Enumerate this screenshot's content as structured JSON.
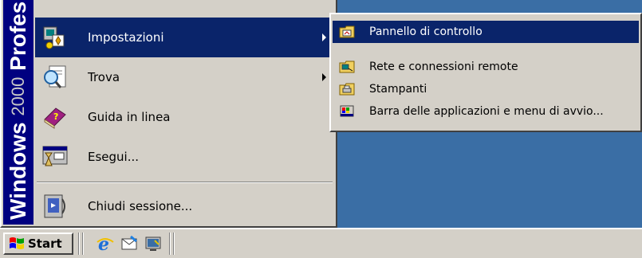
{
  "start_menu": {
    "brand": {
      "windows": "Windows",
      "version": "2000",
      "edition": "Profes"
    },
    "items": [
      {
        "label": "Impostazioni",
        "icon": "settings-icon",
        "has_submenu": true,
        "selected": true
      },
      {
        "label": "Trova",
        "icon": "search-icon",
        "has_submenu": true,
        "selected": false
      },
      {
        "label": "Guida in linea",
        "icon": "help-book-icon",
        "has_submenu": false,
        "selected": false
      },
      {
        "label": "Esegui...",
        "icon": "run-icon",
        "has_submenu": false,
        "selected": false
      },
      {
        "label": "Chiudi sessione...",
        "icon": "logoff-icon",
        "has_submenu": false,
        "selected": false
      }
    ]
  },
  "submenu": {
    "items": [
      {
        "label": "Pannello di controllo",
        "icon": "control-panel-icon",
        "selected": true
      },
      {
        "label": "Rete e connessioni remote",
        "icon": "network-icon",
        "selected": false
      },
      {
        "label": "Stampanti",
        "icon": "printer-folder-icon",
        "selected": false
      },
      {
        "label": "Barra delle applicazioni e menu di avvio...",
        "icon": "taskbar-settings-icon",
        "selected": false
      }
    ]
  },
  "taskbar": {
    "start_label": "Start",
    "quick_launch": [
      "internet-explorer-icon",
      "outlook-express-icon",
      "show-desktop-icon"
    ]
  },
  "colors": {
    "desktop": "#3a6ea5",
    "menu_face": "#d4d0c8",
    "highlight": "#0a246a",
    "brand_strip": "#000080"
  }
}
